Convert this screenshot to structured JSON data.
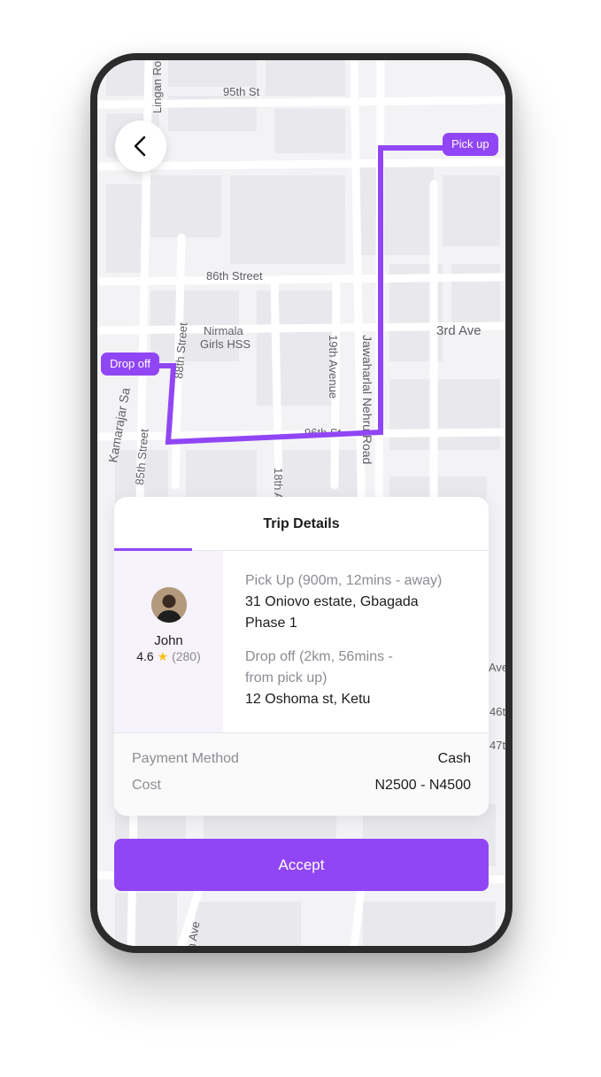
{
  "map": {
    "streets": [
      "95th St",
      "Lingan Ro",
      "86th Street",
      "Nirmala",
      "Girls HSS",
      "3rd Ave",
      "19th Avenue",
      "Jawaharlal Nehru Road",
      "Kamarajar Sa",
      "85th Street",
      "88th Street",
      "18th A",
      "96th St",
      "Ave",
      "46t",
      "47t",
      "h Ave"
    ],
    "pickup_label": "Pick up",
    "dropoff_label": "Drop off",
    "route_color": "#9146f5"
  },
  "back_button": {
    "icon": "chevron-left-icon"
  },
  "trip_card": {
    "title": "Trip Details",
    "driver": {
      "name": "John",
      "rating": "4.6",
      "rating_count": "(280)",
      "icon": "star-icon"
    },
    "pickup": {
      "label": "Pick Up (900m, 12mins - away)",
      "address_line1": "31 Oniovo estate, Gbagada",
      "address_line2": "Phase 1"
    },
    "dropoff": {
      "label_line1": "Drop off (2km, 56mins -",
      "label_line2": "from pick up)",
      "address": "12 Oshoma st, Ketu"
    },
    "payment": {
      "label": "Payment Method",
      "value": "Cash"
    },
    "cost": {
      "label": "Cost",
      "value": "N2500 - N4500"
    }
  },
  "accept_button": {
    "label": "Accept"
  },
  "colors": {
    "accent": "#9146f5",
    "star": "#f6c21c"
  }
}
